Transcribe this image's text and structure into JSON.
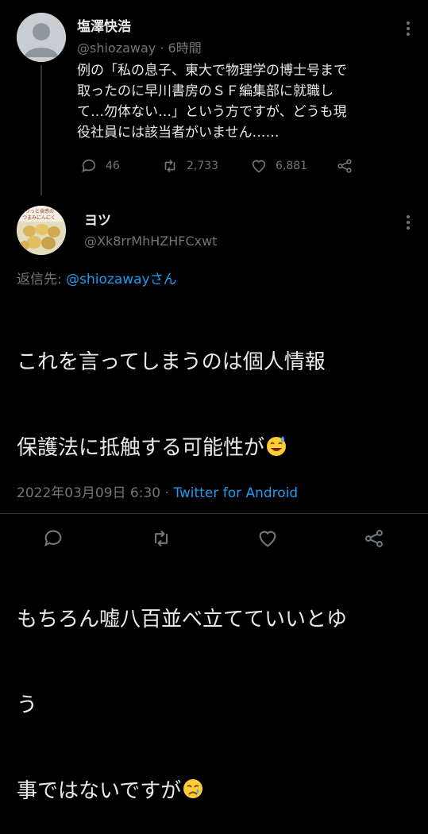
{
  "tweet1": {
    "name": "塩澤快浩",
    "handle": "@shiozaway · 6時間",
    "text": "例の「私の息子、東大で物理学の博士号まで\n取ったのに早川書房のＳＦ編集部に就職し\nて…勿体ない…」という方ですが、どうも現\n役社員には該当者がいません……",
    "replies": "46",
    "retweets": "2,733",
    "likes": "6,881"
  },
  "tweet2": {
    "name": "ヨツ",
    "handle": "@Xk8rrMhHZHFCxwt",
    "reply_prefix": "返信先: ",
    "reply_target": "@shiozawayさん",
    "avatar_text": "カリっと食感の つまみにんにく",
    "text_line1": "これを言ってしまうのは個人情報",
    "text_line2": "保護法に抵触する可能性が",
    "text_line4": "もちろん嘘八百並べ立てていいとゆ",
    "text_line5": "う",
    "text_line6": "事ではないですが",
    "timestamp": "2022年03月09日 6:30 · ",
    "source": "Twitter for Android"
  },
  "icons": [
    "more-icon",
    "reply-icon",
    "retweet-icon",
    "like-icon",
    "share-icon",
    "sweat-smile-emoji",
    "crying-emoji"
  ],
  "colors": {
    "background": "#000000",
    "text": "#e7e9ea",
    "muted": "#71767b",
    "link": "#1d9bf0"
  }
}
